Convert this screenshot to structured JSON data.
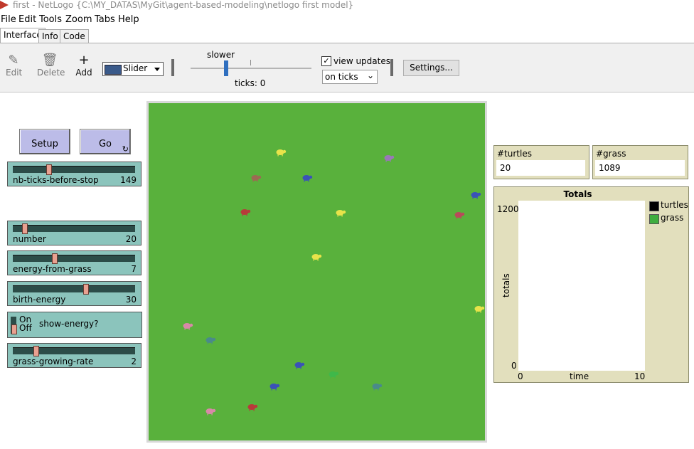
{
  "window": {
    "title": "first - NetLogo {C:\\MY_DATAS\\MyGit\\agent-based-modeling\\netlogo first model}"
  },
  "menu": [
    "File",
    "Edit",
    "Tools",
    "Zoom",
    "Tabs",
    "Help"
  ],
  "tabs": [
    "Interface",
    "Info",
    "Code"
  ],
  "toolbar": {
    "edit_label": "Edit",
    "delete_label": "Delete",
    "add_label": "Add",
    "widget_type": "Slider",
    "speed_label": "slower",
    "ticks_label": "ticks: 0",
    "view_updates_label": "view updates",
    "view_updates_checked": "✓",
    "update_mode": "on ticks",
    "settings_label": "Settings..."
  },
  "buttons": {
    "setup": "Setup",
    "go": "Go",
    "go_forever_icon": "↻"
  },
  "sliders": [
    {
      "name": "nb-ticks-before-stop",
      "value": "149"
    },
    {
      "name": "number",
      "value": "20"
    },
    {
      "name": "energy-from-grass",
      "value": "7"
    },
    {
      "name": "birth-energy",
      "value": "30"
    },
    {
      "name": "grass-growing-rate",
      "value": "2"
    }
  ],
  "switch": {
    "name": "show-energy?",
    "on": "On",
    "off": "Off"
  },
  "monitors": [
    {
      "label": "#turtles",
      "value": "20"
    },
    {
      "label": "#grass",
      "value": "1089"
    }
  ],
  "plot": {
    "title": "Totals",
    "y_max": "1200",
    "y_min": "0",
    "x_min": "0",
    "x_max": "10",
    "xlabel": "time",
    "ylabel": "totals",
    "legend": [
      {
        "name": "turtles",
        "color": "#000000"
      },
      {
        "name": "grass",
        "color": "#3fae3f"
      }
    ]
  },
  "colors": {
    "patch_green": "#59b13c",
    "button_bg": "#bcbce8",
    "slider_bg": "#8bc4bc",
    "monitor_bg": "#e2dfbd"
  },
  "sheep": [
    {
      "color": "#e8e34a"
    },
    {
      "color": "#9a78b8"
    },
    {
      "color": "#9c6a52"
    },
    {
      "color": "#3a52b8"
    },
    {
      "color": "#3a52b8"
    },
    {
      "color": "#b83a3a"
    },
    {
      "color": "#e8e34a"
    },
    {
      "color": "#b84a5a"
    },
    {
      "color": "#e8e34a"
    },
    {
      "color": "#e8e34a"
    },
    {
      "color": "#d889a8"
    },
    {
      "color": "#4a8a8a"
    },
    {
      "color": "#3a52b8"
    },
    {
      "color": "#3fb84a"
    },
    {
      "color": "#3a52b8"
    },
    {
      "color": "#4a8a8a"
    },
    {
      "color": "#d889a8"
    },
    {
      "color": "#b83a3a"
    }
  ]
}
